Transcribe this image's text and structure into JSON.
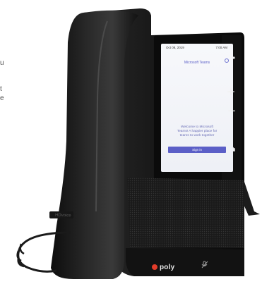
{
  "side_caption": {
    "line1": "u",
    "line2": "t",
    "line3": "e"
  },
  "device": {
    "brand": "poly",
    "handset_brand": "HDvoice",
    "body_color": "#141414",
    "brand_accent": "#e23c2a"
  },
  "screen": {
    "date": "Oct 08, 2019",
    "time": "7:00 AM",
    "app_title": "Microsoft Teams",
    "welcome_lines": [
      "Welcome to Microsoft",
      "Teams! A happier place for",
      "teams to work together"
    ],
    "signin_label": "Sign in",
    "accent": "#5b5fc7"
  },
  "side_keys": {
    "plus": "+",
    "minus": "−",
    "icons": [
      "teams-icon",
      "headset-icon",
      "speaker-icon",
      "mic-mute-icon"
    ]
  }
}
